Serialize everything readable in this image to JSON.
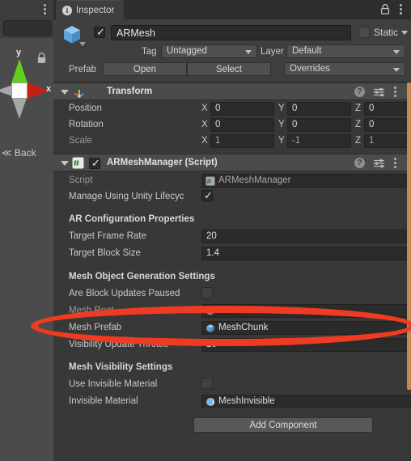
{
  "scene_panel": {
    "kebab_icon": "kebab-menu-icon",
    "lock_icon": "lock-icon",
    "gizmo": {
      "axis_y_label": "y",
      "axis_x_label": "x",
      "y_cone_color": "#5fd020",
      "x_cone_color": "#c82010",
      "neutral_cone_color": "#a8a8a8"
    },
    "view_mode_label": "≪ Back"
  },
  "inspector": {
    "tab": {
      "label": "Inspector",
      "icon": "info-icon"
    },
    "lock_icon": "lock-icon",
    "kebab_icon": "kebab-menu-icon",
    "gameobject": {
      "icon": "cube-icon",
      "enabled": true,
      "name": "ARMesh",
      "static_label": "Static",
      "static_checked": false,
      "tag_label": "Tag",
      "tag_value": "Untagged",
      "layer_label": "Layer",
      "layer_value": "Default",
      "prefab_label": "Prefab",
      "prefab_open_label": "Open",
      "prefab_select_label": "Select",
      "prefab_overrides_label": "Overrides"
    },
    "transform": {
      "title": "Transform",
      "icon": "transform-gizmo-icon",
      "help_icon": "help-icon",
      "preset_icon": "preset-settings-icon",
      "kebab_icon": "kebab-menu-icon",
      "rows": [
        {
          "label": "Position",
          "x": "0",
          "y": "0",
          "z": "0",
          "dim": false
        },
        {
          "label": "Rotation",
          "x": "0",
          "y": "0",
          "z": "0",
          "dim": false
        },
        {
          "label": "Scale",
          "x": "1",
          "y": "-1",
          "z": "1",
          "dim": true
        }
      ],
      "axis_labels": {
        "x": "X",
        "y": "Y",
        "z": "Z"
      }
    },
    "armeshmanager": {
      "title": "ARMeshManager (Script)",
      "icon": "csharp-script-icon",
      "enabled": true,
      "help_icon": "help-icon",
      "preset_icon": "preset-settings-icon",
      "kebab_icon": "kebab-menu-icon",
      "script_label": "Script",
      "script_value": "ARMeshManager",
      "manage_lifecycle_label": "Manage Using Unity Lifecyc",
      "manage_lifecycle_checked": true,
      "section_ar_config": "AR Configuration Properties",
      "target_frame_rate_label": "Target Frame Rate",
      "target_frame_rate_value": "20",
      "target_block_size_label": "Target Block Size",
      "target_block_size_value": "1.4",
      "section_mesh_gen": "Mesh Object Generation Settings",
      "block_updates_paused_label": "Are Block Updates Paused",
      "block_updates_paused_checked": false,
      "mesh_root_label": "Mesh Root",
      "mesh_root_value": "ARMesh",
      "mesh_prefab_label": "Mesh Prefab",
      "mesh_prefab_value": "MeshChunk",
      "visibility_throttle_label": "Visibility Update Throttle",
      "visibility_throttle_value": "10",
      "section_mesh_vis": "Mesh Visibility Settings",
      "use_invisible_material_label": "Use Invisible Material",
      "use_invisible_material_checked": false,
      "invisible_material_label": "Invisible Material",
      "invisible_material_value": "MeshInvisible"
    },
    "add_component_label": "Add Component",
    "scrollbar_color": "#c98850"
  },
  "annotation": {
    "shape": "ellipse",
    "color": "#ef3b22"
  }
}
